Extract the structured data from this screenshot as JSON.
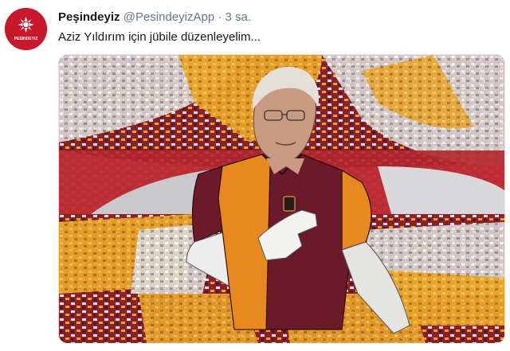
{
  "tweet": {
    "author_name": "Peşindeyiz",
    "handle": "@PesindeyizApp",
    "separator": "·",
    "timestamp": "3 sa.",
    "text": "Aziz Yıldırım için jübile düzenleyelim...",
    "avatar_text": "PESINDEYIZ",
    "avatar_color": "#c9182b"
  },
  "media": {
    "type": "image",
    "colors": {
      "crowd_red": "#8a1f2e",
      "crowd_yellow": "#e8a32a",
      "crowd_white": "#e8e8e6",
      "jersey_maroon": "#6b1a2a",
      "jersey_orange": "#e8891f"
    }
  }
}
